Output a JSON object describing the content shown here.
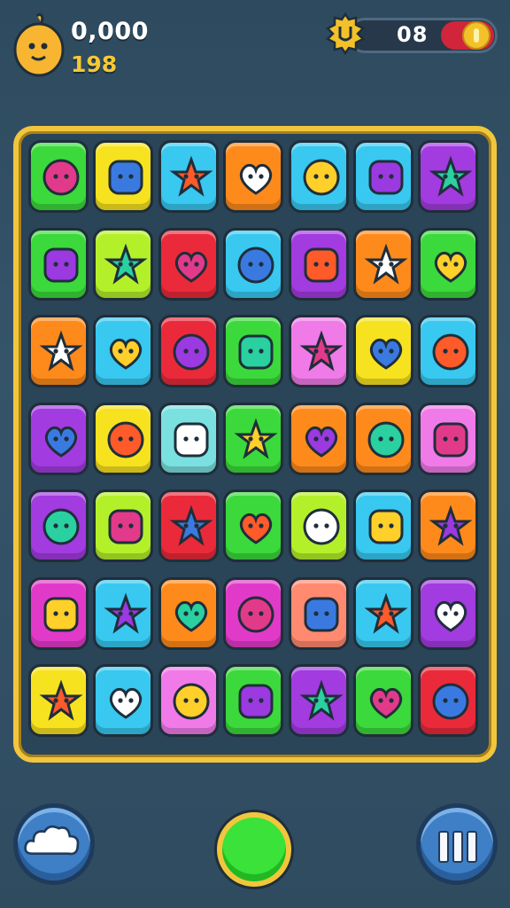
{
  "hud": {
    "score": "0,000",
    "sub_score": "198",
    "moves": "08"
  },
  "colors": {
    "board_border": "#f2c63c",
    "background": "#35546a",
    "play_button": "#3ae23a",
    "round_button": "#3e7fc6"
  },
  "board": {
    "rows": 7,
    "cols": 7,
    "tiles": [
      [
        "green",
        "lollipop-icon"
      ],
      [
        "yellow",
        "strawberry-face-icon"
      ],
      [
        "cyan",
        "candy-bar-icon"
      ],
      [
        "orange",
        "swirl-icon"
      ],
      [
        "cyan",
        "magenta-ring-icon"
      ],
      [
        "cyan",
        "striped-leaf-icon"
      ],
      [
        "purple",
        "eggplant-icon"
      ],
      [
        "green",
        "purple-blob-icon"
      ],
      [
        "lime",
        "paintbrush-icon"
      ],
      [
        "red",
        "blue-bear-icon"
      ],
      [
        "cyan",
        "strawberry-icon"
      ],
      [
        "purple",
        "smiley-face-icon"
      ],
      [
        "orange",
        "ice-cream-cone-icon"
      ],
      [
        "green",
        "red-drop-face-icon"
      ],
      [
        "orange",
        "yellow-creature-icon"
      ],
      [
        "cyan",
        "fish-icon"
      ],
      [
        "red",
        "yarn-ball-icon"
      ],
      [
        "green",
        "purple-shell-icon"
      ],
      [
        "pink",
        "purple-ghost-icon"
      ],
      [
        "yellow",
        "purple-bird-icon"
      ],
      [
        "cyan",
        "star-face-icon"
      ],
      [
        "purple",
        "alarm-clock-icon"
      ],
      [
        "yellow",
        "purple-bar-icon"
      ],
      [
        "teal",
        "teal-robot-icon"
      ],
      [
        "green",
        "paint-pen-icon"
      ],
      [
        "orange",
        "magenta-dress-icon"
      ],
      [
        "orange",
        "magenta-tassel-icon"
      ],
      [
        "pink",
        "blue-hoodie-icon"
      ],
      [
        "purple",
        "white-star-icon"
      ],
      [
        "lime",
        "red-heart-icon"
      ],
      [
        "red",
        "machine-icon"
      ],
      [
        "green",
        "purple-cone-icon"
      ],
      [
        "lime",
        "purple-pen-icon"
      ],
      [
        "cyan",
        "golden-box-icon"
      ],
      [
        "orange",
        "yellow-monster-icon"
      ],
      [
        "magenta",
        "sun-face-icon"
      ],
      [
        "cyan",
        "heart-icon"
      ],
      [
        "orange",
        "green-lollipop-icon"
      ],
      [
        "magenta",
        "purple-lollipop-icon"
      ],
      [
        "salmon",
        "paintbrush-blue-icon"
      ],
      [
        "cyan",
        "yellow-drop-face-icon"
      ],
      [
        "purple",
        "blue-splat-icon"
      ],
      [
        "yellow",
        "pink-star-icon"
      ],
      [
        "cyan",
        "yellow-tent-icon"
      ],
      [
        "pink",
        "green-sprout-icon"
      ],
      [
        "green",
        "carrot-brush-icon"
      ],
      [
        "purple",
        "pink-alien-icon"
      ],
      [
        "green",
        "flame-icon"
      ],
      [
        "red",
        "red-bear-icon"
      ]
    ]
  },
  "buttons": {
    "left": "cloud-button",
    "center": "play-button",
    "right": "pause-button"
  }
}
